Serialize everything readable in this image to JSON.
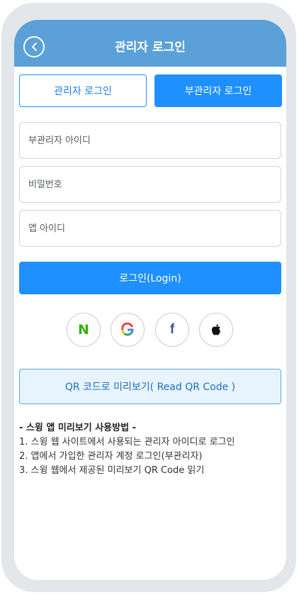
{
  "header": {
    "title": "관리자 로그인",
    "back_icon": "chevron-left-icon"
  },
  "tabs": {
    "admin_label": "관리자 로그인",
    "sub_admin_label": "부관리자 로그인",
    "active": "sub_admin"
  },
  "form": {
    "sub_admin_id_placeholder": "부관리자 아이디",
    "password_placeholder": "비밀번호",
    "app_id_placeholder": "앱 아이디",
    "sub_admin_id_value": "",
    "password_value": "",
    "app_id_value": ""
  },
  "login_button": {
    "label": "로그인(Login)"
  },
  "social": {
    "naver_letter": "N",
    "facebook_letter": "f",
    "icons": [
      "naver-icon",
      "google-icon",
      "facebook-icon",
      "apple-icon"
    ]
  },
  "qr_button": {
    "label": "QR 코드로 미리보기( Read QR Code )"
  },
  "guide": {
    "title": "- 스윙 앱 미리보기 사용방법 -",
    "steps": [
      "1. 스윙 웹 사이트에서 사용되는 관리자 아이디로 로그인",
      "2. 앱에서 가입한 관리자 계정 로그인(부관리자)",
      "3. 스윙 웹에서 제공된 미리보기 QR Code 읽기"
    ]
  },
  "colors": {
    "header_bg": "#5ba0d8",
    "primary": "#1e90ff",
    "qr_bg": "#e8f4fd",
    "naver": "#2db400",
    "facebook": "#3b5998"
  }
}
